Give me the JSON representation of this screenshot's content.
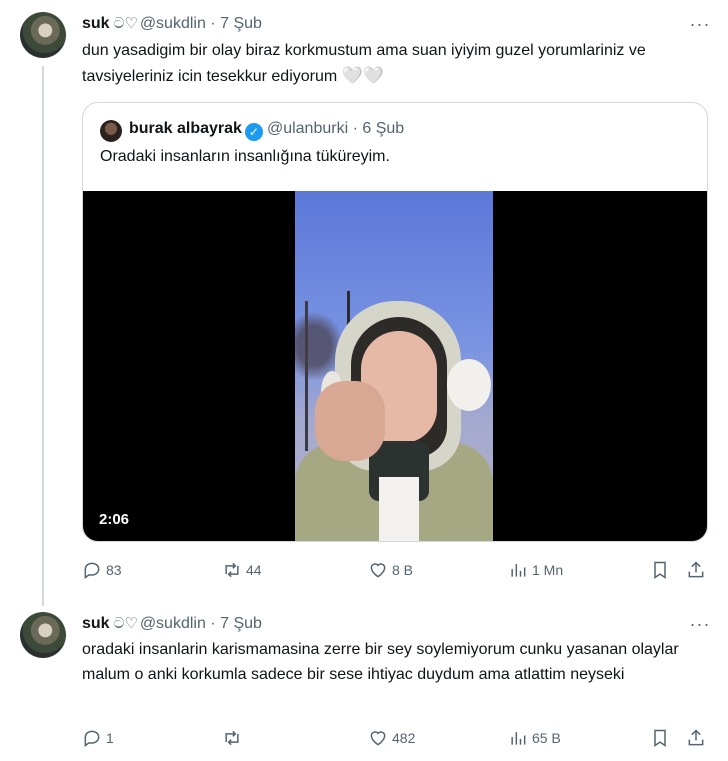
{
  "tweet1": {
    "display_name": "suk",
    "name_glyph": "ට♡",
    "handle": "@sukdlin",
    "time": "7 Şub",
    "text": "dun yasadigim bir olay biraz korkmustum ama suan iyiyim guzel yorumlariniz ve tavsiyeleriniz icin tesekkur ediyorum",
    "hearts": "🤍🤍",
    "quote": {
      "display_name": "burak albayrak",
      "handle": "@ulanburki",
      "time": "6 Şub",
      "text": "Oradaki insanların insanlığına tüküreyim.",
      "video_duration": "2:06"
    },
    "stats": {
      "replies": "83",
      "retweets": "44",
      "likes": "8 B",
      "views": "1 Mn"
    }
  },
  "tweet2": {
    "display_name": "suk",
    "name_glyph": "ට♡",
    "handle": "@sukdlin",
    "time": "7 Şub",
    "text": "oradaki insanlarin karismamasina zerre bir sey soylemiyorum cunku yasanan olaylar malum o anki korkumla sadece bir sese ihtiyac duydum ama atlattim neyseki",
    "stats": {
      "replies": "1",
      "retweets": "",
      "likes": "482",
      "views": "65 B"
    }
  },
  "ui": {
    "dot": "·",
    "more": "···",
    "verified_check": "✓"
  },
  "colors": {
    "accent": "#1d9bf0",
    "muted": "#536471",
    "border": "#cfd9de"
  }
}
